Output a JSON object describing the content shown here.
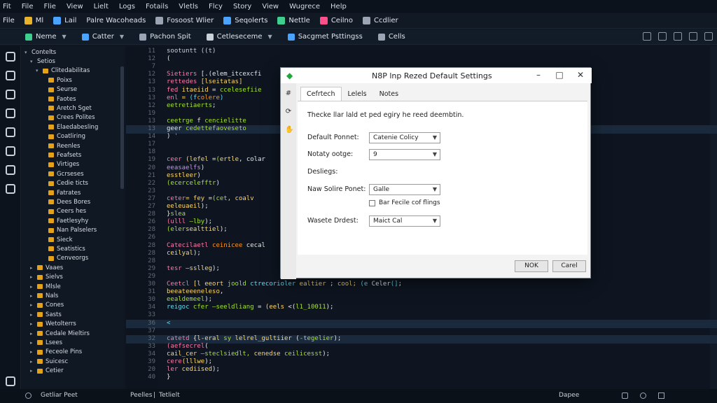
{
  "menubar": [
    "Fit",
    "File",
    "Flie",
    "View",
    "Lielt",
    "Logs",
    "Fotails",
    "Vletls",
    "Flcy",
    "Story",
    "View",
    "Wugrece",
    "Help"
  ],
  "toolbar1": [
    {
      "label": "File",
      "icon": "none",
      "color": ""
    },
    {
      "label": "Ml",
      "icon": "star-icon",
      "color": "#e8b22b"
    },
    {
      "label": "Lail",
      "icon": "flag-icon",
      "color": "#4aa3ff"
    },
    {
      "label": "Palre Wacoheads",
      "icon": "none",
      "color": ""
    },
    {
      "label": "Fosoost Wlier",
      "icon": "grid-icon",
      "color": "#9aa4b2"
    },
    {
      "label": "Seqolerts",
      "icon": "layers-icon",
      "color": "#4aa3ff"
    },
    {
      "label": "Nettle",
      "icon": "circle-icon",
      "color": "#3ecf8e"
    },
    {
      "label": "Ceilno",
      "icon": "ball-icon",
      "color": "#ff4f8b"
    },
    {
      "label": "Ccdlier",
      "icon": "pin-icon",
      "color": "#9aa4b2"
    }
  ],
  "toolbar2": [
    {
      "label": "Neme",
      "icon": "tag-icon",
      "color": "#3ecf8e",
      "dropdown": true
    },
    {
      "label": "Catter",
      "icon": "gear-icon",
      "color": "#4aa3ff",
      "dropdown": true
    },
    {
      "label": "Pachon Spit",
      "icon": "grid-icon",
      "color": "#9aa4b2",
      "dropdown": false
    },
    {
      "label": "Cetleseceme",
      "icon": "edit-icon",
      "color": "#c9d1d9",
      "dropdown": true
    },
    {
      "label": "Sacgmet Psttingss",
      "icon": "bar-icon",
      "color": "#4aa3ff",
      "dropdown": false
    },
    {
      "label": "Cells",
      "icon": "grid-icon",
      "color": "#9aa4b2",
      "dropdown": false
    }
  ],
  "explorer": [
    {
      "label": "Contelts",
      "depth": 0,
      "folder": false,
      "open": true
    },
    {
      "label": "Setios",
      "depth": 1,
      "folder": false,
      "open": true
    },
    {
      "label": "Clitedabilitas",
      "depth": 2,
      "folder": true,
      "open": true
    },
    {
      "label": "Poixs",
      "depth": 3,
      "folder": true
    },
    {
      "label": "Seurse",
      "depth": 3,
      "folder": true
    },
    {
      "label": "Faotes",
      "depth": 3,
      "folder": true
    },
    {
      "label": "Aretch Sget",
      "depth": 3,
      "folder": true
    },
    {
      "label": "Crees Polites",
      "depth": 3,
      "folder": true
    },
    {
      "label": "Elaedabesling",
      "depth": 3,
      "folder": true
    },
    {
      "label": "Coatliring",
      "depth": 3,
      "folder": true
    },
    {
      "label": "Reenles",
      "depth": 3,
      "folder": true
    },
    {
      "label": "Feafsets",
      "depth": 3,
      "folder": true
    },
    {
      "label": "Virtiges",
      "depth": 3,
      "folder": true
    },
    {
      "label": "Gcrseses",
      "depth": 3,
      "folder": true
    },
    {
      "label": "Cedie ticts",
      "depth": 3,
      "folder": true
    },
    {
      "label": "Fatrates",
      "depth": 3,
      "folder": true
    },
    {
      "label": "Dees Bores",
      "depth": 3,
      "folder": true
    },
    {
      "label": "Ceers hes",
      "depth": 3,
      "folder": true
    },
    {
      "label": "Faetlesyhy",
      "depth": 3,
      "folder": true
    },
    {
      "label": "Nan Palselers",
      "depth": 3,
      "folder": true
    },
    {
      "label": "Sieck",
      "depth": 3,
      "folder": true
    },
    {
      "label": "Seatistics",
      "depth": 3,
      "folder": true
    },
    {
      "label": "Cenveorgs",
      "depth": 3,
      "folder": true
    },
    {
      "label": "Vaaes",
      "depth": 1,
      "folder": true
    },
    {
      "label": "Sielvs",
      "depth": 1,
      "folder": true
    },
    {
      "label": "Mlsle",
      "depth": 1,
      "folder": true
    },
    {
      "label": "Nals",
      "depth": 1,
      "folder": true
    },
    {
      "label": "Cones",
      "depth": 1,
      "folder": true
    },
    {
      "label": "Sasts",
      "depth": 1,
      "folder": true
    },
    {
      "label": "Wetolterrs",
      "depth": 1,
      "folder": true
    },
    {
      "label": "Cedale Mieltirs",
      "depth": 1,
      "folder": true
    },
    {
      "label": "Lsees",
      "depth": 1,
      "folder": true
    },
    {
      "label": "Feceole Pins",
      "depth": 1,
      "folder": true
    },
    {
      "label": "Suicesc",
      "depth": 1,
      "folder": true
    },
    {
      "label": "Cetier",
      "depth": 1,
      "folder": true
    }
  ],
  "code": [
    {
      "n": "11",
      "t": [
        [
          "e",
          "sootuntt ((t)"
        ]
      ]
    },
    {
      "n": "12",
      "t": [
        [
          "v",
          "    ("
        ]
      ]
    },
    {
      "n": "7",
      "t": []
    },
    {
      "n": "12",
      "t": [
        [
          "k",
          "  Sietiers"
        ],
        [
          "v",
          " [.(elem_itcexcfi"
        ]
      ]
    },
    {
      "n": "13",
      "t": [
        [
          "k",
          "  rettedes"
        ],
        [
          "v",
          "  "
        ],
        [
          "f",
          "[lseitatas]"
        ]
      ]
    },
    {
      "n": "13",
      "t": [
        [
          "v",
          "    "
        ],
        [
          "k",
          "fed"
        ],
        [
          "f",
          " itaeiid"
        ],
        [
          "v",
          " = "
        ],
        [
          "s",
          "ccelesefiie"
        ]
      ]
    },
    {
      "n": "13",
      "t": [
        [
          "v",
          "      "
        ],
        [
          "k",
          "enl"
        ],
        [
          "f",
          " ="
        ],
        [
          "b",
          " (f"
        ],
        [
          "o",
          "colere"
        ],
        [
          "b",
          ")"
        ]
      ]
    },
    {
      "n": "12",
      "t": [
        [
          "v",
          "      "
        ],
        [
          "s",
          "eetretiaerts"
        ],
        [
          "v",
          ";"
        ]
      ]
    },
    {
      "n": "19",
      "t": []
    },
    {
      "n": "13",
      "t": [
        [
          "v",
          "        "
        ],
        [
          "s",
          "ceetrge"
        ],
        [
          "v",
          " f "
        ],
        [
          "s",
          "cencielitte"
        ]
      ]
    },
    {
      "n": "13",
      "t": [
        [
          "v",
          "      "
        ],
        [
          "v",
          "geer"
        ],
        [
          "s",
          " cedettefaoveseto"
        ]
      ],
      "hl": true
    },
    {
      "n": "14",
      "t": [
        [
          "v",
          "    )"
        ],
        [
          "o",
          " '"
        ]
      ]
    },
    {
      "n": "17",
      "t": []
    },
    {
      "n": "18",
      "t": []
    },
    {
      "n": "19",
      "t": [
        [
          "k",
          "  ceer"
        ],
        [
          "f",
          " (lefel"
        ],
        [
          "v",
          " ="
        ],
        [
          "s",
          "("
        ],
        [
          "f",
          "ertle"
        ],
        [
          "v",
          ", colar"
        ]
      ]
    },
    {
      "n": "20",
      "t": [
        [
          "v",
          "        "
        ],
        [
          "p",
          "eeasaelfs"
        ],
        [
          "v",
          ")"
        ]
      ]
    },
    {
      "n": "21",
      "t": [
        [
          "v",
          "        "
        ],
        [
          "f",
          "esstleer"
        ],
        [
          "v",
          ")"
        ]
      ]
    },
    {
      "n": "22",
      "t": [
        [
          "v",
          "    "
        ],
        [
          "s",
          "(ecercelefftr"
        ],
        [
          "v",
          ")"
        ]
      ]
    },
    {
      "n": "23",
      "t": []
    },
    {
      "n": "27",
      "t": [
        [
          "k",
          "  ceter"
        ],
        [
          "f",
          "= fey"
        ],
        [
          "v",
          " ="
        ],
        [
          "s",
          "(cet"
        ],
        [
          "f",
          ", coalv"
        ]
      ]
    },
    {
      "n": "27",
      "t": [
        [
          "v",
          "        "
        ],
        [
          "f",
          "eeleuaeil"
        ],
        [
          "v",
          ");"
        ]
      ]
    },
    {
      "n": "28",
      "t": [
        [
          "v",
          "      "
        ],
        [
          "v",
          "}"
        ],
        [
          "s",
          "slea"
        ]
      ]
    },
    {
      "n": "26",
      "t": [
        [
          "v",
          "    "
        ],
        [
          "k",
          "(ulll"
        ],
        [
          "s",
          " —lby"
        ],
        [
          "v",
          ");"
        ]
      ]
    },
    {
      "n": "28",
      "t": [
        [
          "v",
          "    "
        ],
        [
          "s",
          "(eler"
        ],
        [
          "f",
          "sealttiel"
        ],
        [
          "v",
          ");"
        ]
      ]
    },
    {
      "n": "26",
      "t": []
    },
    {
      "n": "28",
      "t": [
        [
          "k",
          "Catecilaetl"
        ],
        [
          "v",
          " "
        ],
        [
          "o",
          "ceinicee"
        ],
        [
          "v",
          " cecal"
        ]
      ]
    },
    {
      "n": "28",
      "t": [
        [
          "v",
          "    "
        ],
        [
          "f",
          "ceilyal"
        ],
        [
          "v",
          ");"
        ]
      ]
    },
    {
      "n": "28",
      "t": []
    },
    {
      "n": "29",
      "t": [
        [
          "v",
          "    "
        ],
        [
          "k",
          "tesr"
        ],
        [
          "f",
          " —sslleg"
        ],
        [
          "v",
          ");"
        ]
      ]
    },
    {
      "n": "29",
      "t": []
    },
    {
      "n": "30",
      "t": [
        [
          "v",
          "    "
        ],
        [
          "k",
          "Ceetcl"
        ],
        [
          "f",
          " [l eeort"
        ],
        [
          "s",
          " joold"
        ],
        [
          "b",
          " ctrecorioler"
        ],
        [
          "f",
          " ealtier"
        ],
        [
          "v",
          " ; "
        ],
        [
          "f",
          "cool;"
        ],
        [
          "b",
          " (e"
        ],
        [
          "v",
          " Celer"
        ],
        [
          "b",
          "(]"
        ],
        [
          "v",
          ";"
        ]
      ]
    },
    {
      "n": "31",
      "t": [
        [
          "v",
          "    "
        ],
        [
          "f",
          "beeateeeneleso"
        ],
        [
          "v",
          ","
        ]
      ]
    },
    {
      "n": "30",
      "t": [
        [
          "v",
          "        "
        ],
        [
          "s",
          "eealdemeel"
        ],
        [
          "v",
          ");"
        ]
      ]
    },
    {
      "n": "34",
      "t": [
        [
          "v",
          "      "
        ],
        [
          "b",
          "reigoc"
        ],
        [
          "s",
          " cfer —seeldliang"
        ],
        [
          "v",
          " = "
        ],
        [
          "f",
          "(eels"
        ],
        [
          "v",
          " <("
        ],
        [
          "s",
          "l1_10011"
        ],
        [
          "v",
          ");"
        ]
      ]
    },
    {
      "n": "33",
      "t": []
    },
    {
      "n": "36",
      "t": [
        [
          "b",
          "  <"
        ]
      ],
      "hl": true
    },
    {
      "n": "37",
      "t": []
    },
    {
      "n": "32",
      "t": [
        [
          "v",
          "    "
        ],
        [
          "k",
          "catetd"
        ],
        [
          "v",
          " {"
        ],
        [
          "f",
          "l-eral"
        ],
        [
          "s",
          " sy"
        ],
        [
          "f",
          " lelrel_gultiier"
        ],
        [
          "v",
          " ("
        ],
        [
          "s",
          "-tegelier"
        ],
        [
          "v",
          ");"
        ]
      ],
      "hl": true
    },
    {
      "n": "33",
      "t": [
        [
          "v",
          "    "
        ],
        [
          "k",
          "(aefsecrel"
        ],
        [
          "v",
          "("
        ]
      ]
    },
    {
      "n": "34",
      "t": [
        [
          "v",
          "        "
        ],
        [
          "f",
          "cail_cer"
        ],
        [
          "s",
          " —steclsiedlt,"
        ],
        [
          "f",
          " cenedse"
        ],
        [
          "s",
          " ceilicesst"
        ],
        [
          "v",
          ");"
        ]
      ]
    },
    {
      "n": "39",
      "t": [
        [
          "v",
          "        "
        ],
        [
          "k",
          "cere"
        ],
        [
          "f",
          "(lllwe"
        ],
        [
          "v",
          ");"
        ]
      ]
    },
    {
      "n": "20",
      "t": [
        [
          "v",
          "    "
        ],
        [
          "k",
          "ler"
        ],
        [
          "f",
          " cediised"
        ],
        [
          "v",
          ");"
        ]
      ]
    },
    {
      "n": "40",
      "t": [
        [
          "v",
          "  }"
        ]
      ]
    }
  ],
  "dialog": {
    "title": "N8P lnp Rezed Default Settings",
    "tabs": [
      "Cefrtech",
      "Lelels",
      "Notes"
    ],
    "description": "Thecke llar lald et ped egiry he reed deembtin.",
    "fields": [
      {
        "label": "Default Ponnet:",
        "value": "Catenie Colicy"
      },
      {
        "label": "Notaty ootge:",
        "value": "9"
      }
    ],
    "section_label": "Desliegs:",
    "fields2": [
      {
        "label": "Naw Solire Ponet:",
        "value": "Galle"
      }
    ],
    "checkbox_label": "Bar Fecile cof flings",
    "fields3": [
      {
        "label": "Wasete Drdest:",
        "value": "Maict Cal"
      }
    ],
    "ok_label": "NOK",
    "cancel_label": "Carel"
  },
  "status": {
    "left_label": "Getliar Peet",
    "mid1": "Peelles",
    "mid2": "Tetlielt",
    "right_label": "Dapee"
  }
}
